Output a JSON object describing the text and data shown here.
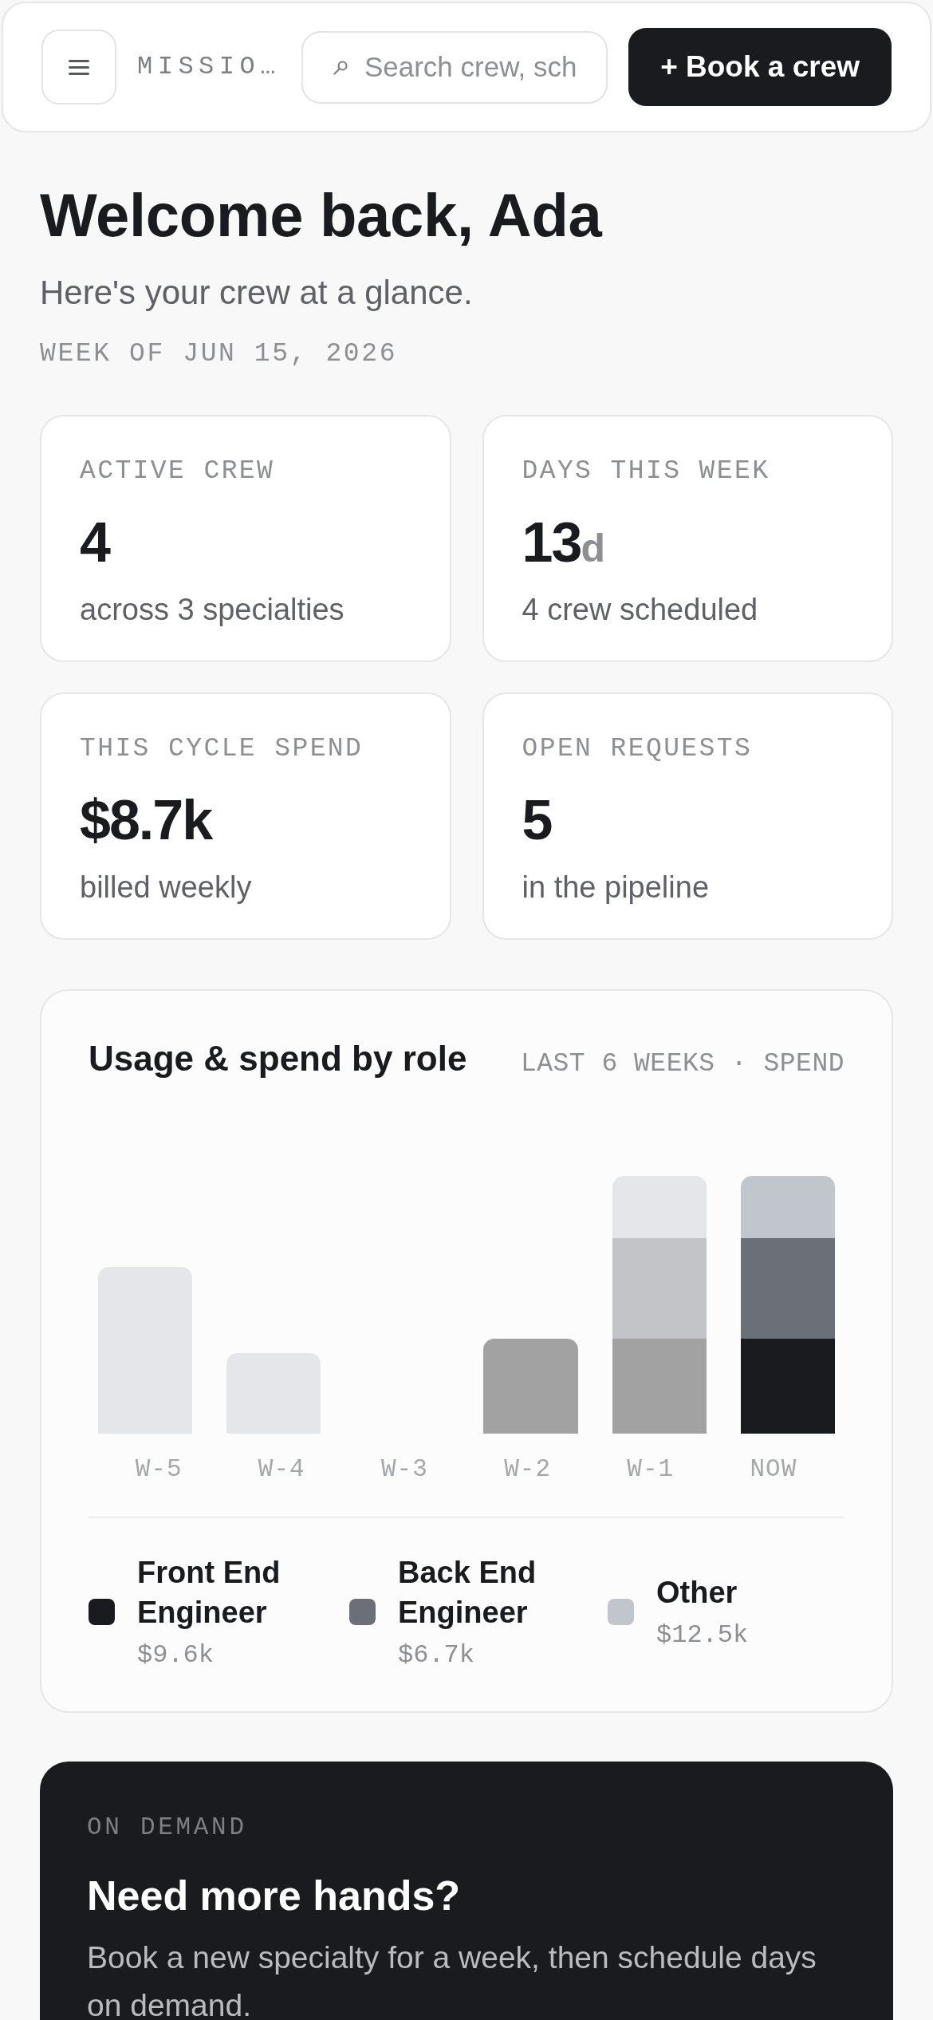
{
  "header": {
    "title": "MISSIO…",
    "search": {
      "placeholder": "Search crew, sch"
    },
    "action": "+ Book a crew"
  },
  "welcome": {
    "title": "Welcome back, Ada",
    "subtitle": "Here's your crew at a glance.",
    "week": "WEEK OF JUN 15, 2026"
  },
  "stats": [
    {
      "label": "ACTIVE CREW",
      "value": "4",
      "note": "across 3 specialties"
    },
    {
      "label": "DAYS THIS WEEK",
      "value": "13",
      "unit": "d",
      "note": "4 crew scheduled"
    },
    {
      "label": "THIS CYCLE SPEND",
      "value": "$8.7k",
      "note": "billed weekly"
    },
    {
      "label": "OPEN REQUESTS",
      "value": "5",
      "note": "in the pipeline"
    }
  ],
  "chart_card": {
    "title": "Usage & spend by role",
    "subtitle": "LAST 6 WEEKS · SPEND",
    "week_labels": [
      "W-5",
      "W-4",
      "W-3",
      "W-2",
      "W-1",
      "NOW"
    ],
    "legend": [
      {
        "label": "Front End Engineer",
        "value": "$9.6k",
        "color": "#1a1b1e"
      },
      {
        "label": "Back End Engineer",
        "value": "$6.7k",
        "color": "#6b7078"
      },
      {
        "label": "Other",
        "value": "$12.5k",
        "color": "#c1c5cc"
      }
    ]
  },
  "promo": {
    "eyebrow": "ON DEMAND",
    "title": "Need more hands?",
    "body": "Book a new specialty for a week, then schedule days on demand."
  }
}
